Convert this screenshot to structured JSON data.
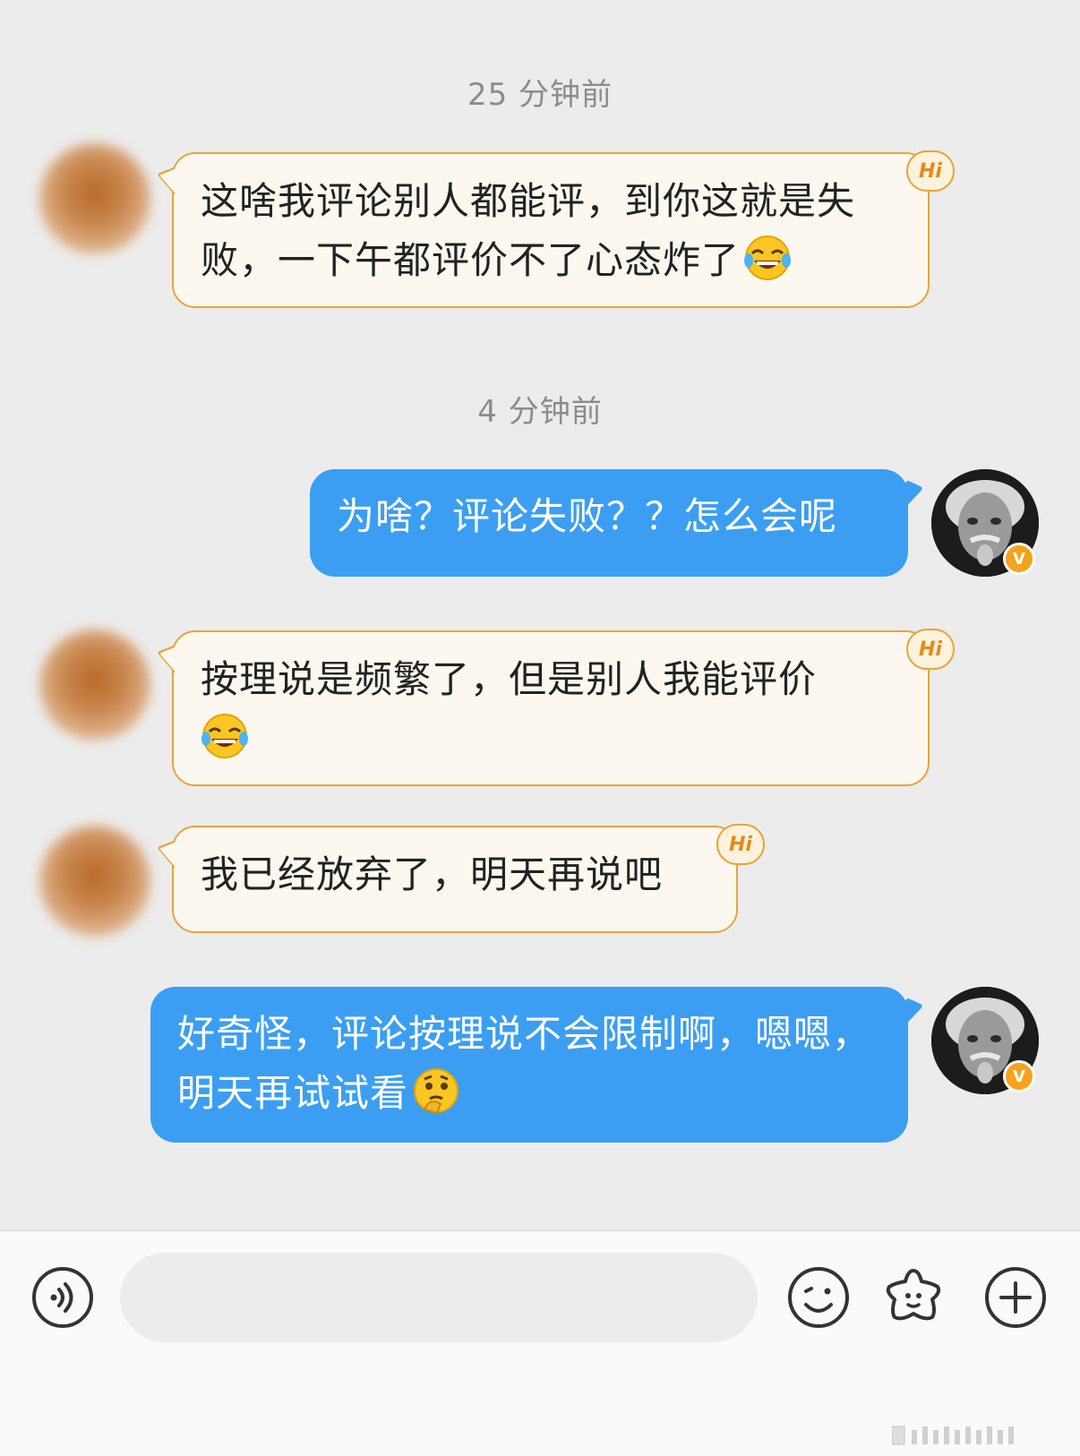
{
  "timestamps": [
    "25 分钟前",
    "4 分钟前"
  ],
  "messages": [
    {
      "from": "other",
      "text": "这啥我评论别人都能评，到你这就是失败，一下午都评价不了心态炸了",
      "emoji": "laugh-cry",
      "badge": "Hi"
    },
    {
      "from": "me",
      "text": "为啥？评论失败？？怎么会呢"
    },
    {
      "from": "other",
      "text": "按理说是频繁了，但是别人我能评价",
      "emoji": "laugh-cry",
      "badge": "Hi"
    },
    {
      "from": "other",
      "text": "我已经放弃了，明天再说吧",
      "badge": "Hi"
    },
    {
      "from": "me",
      "text": "好奇怪，评论按理说不会限制啊，嗯嗯，明天再试试看",
      "emoji": "thinking"
    }
  ],
  "me_avatar": {
    "badge": "V",
    "badge_color": "#f6a21a"
  },
  "colors": {
    "outgoing": "#3c9ef3",
    "incoming_bg": "#fcf8ef",
    "incoming_border": "#e7a43a",
    "background": "#ececec"
  },
  "input_bar": {
    "placeholder": "",
    "icons": [
      "voice-icon",
      "emoji-icon",
      "sticker-star-icon",
      "plus-icon"
    ]
  }
}
